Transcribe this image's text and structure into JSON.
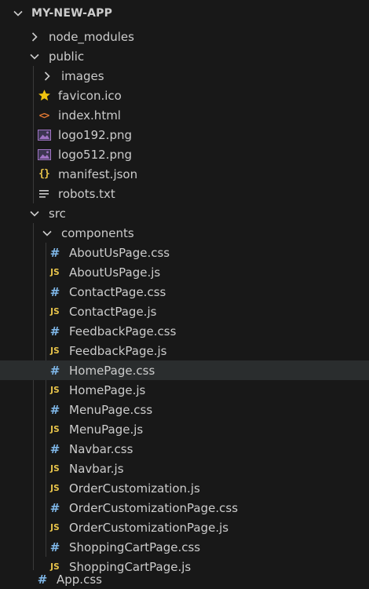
{
  "explorer": {
    "title": "MY-NEW-APP",
    "items": [
      {
        "label": "node_modules",
        "icon": "chevron-right-icon"
      },
      {
        "label": "public",
        "icon": "chevron-down-icon"
      },
      {
        "label": "images",
        "icon": "chevron-right-icon"
      },
      {
        "label": "favicon.ico",
        "icon": "star-icon"
      },
      {
        "label": "index.html",
        "icon": "html-icon"
      },
      {
        "label": "logo192.png",
        "icon": "image-icon"
      },
      {
        "label": "logo512.png",
        "icon": "image-icon"
      },
      {
        "label": "manifest.json",
        "icon": "json-icon"
      },
      {
        "label": "robots.txt",
        "icon": "text-lines-icon"
      },
      {
        "label": "src",
        "icon": "chevron-down-icon"
      },
      {
        "label": "components",
        "icon": "chevron-down-icon"
      },
      {
        "label": "AboutUsPage.css",
        "icon": "css-icon"
      },
      {
        "label": "AboutUsPage.js",
        "icon": "js-icon"
      },
      {
        "label": "ContactPage.css",
        "icon": "css-icon"
      },
      {
        "label": "ContactPage.js",
        "icon": "js-icon"
      },
      {
        "label": "FeedbackPage.css",
        "icon": "css-icon"
      },
      {
        "label": "FeedbackPage.js",
        "icon": "js-icon"
      },
      {
        "label": "HomePage.css",
        "icon": "css-icon",
        "selected": true
      },
      {
        "label": "HomePage.js",
        "icon": "js-icon"
      },
      {
        "label": "MenuPage.css",
        "icon": "css-icon"
      },
      {
        "label": "MenuPage.js",
        "icon": "js-icon"
      },
      {
        "label": "Navbar.css",
        "icon": "css-icon"
      },
      {
        "label": "Navbar.js",
        "icon": "js-icon"
      },
      {
        "label": "OrderCustomization.js",
        "icon": "js-icon"
      },
      {
        "label": "OrderCustomizationPage.css",
        "icon": "css-icon"
      },
      {
        "label": "OrderCustomizationPage.js",
        "icon": "js-icon"
      },
      {
        "label": "ShoppingCartPage.css",
        "icon": "css-icon"
      },
      {
        "label": "ShoppingCartPage.js",
        "icon": "js-icon"
      },
      {
        "label": "App.css",
        "icon": "css-icon"
      }
    ]
  },
  "glyphs": {
    "js": "JS",
    "css": "#",
    "json": "{}",
    "html": "<>"
  },
  "colors": {
    "background": "#181818",
    "selected_row": "#2a2d2e",
    "text": "#cccccc",
    "js": "#e8c44a",
    "css": "#7fb7e8",
    "html": "#e37933",
    "star": "#f1c40f",
    "image": "#a074c4"
  }
}
